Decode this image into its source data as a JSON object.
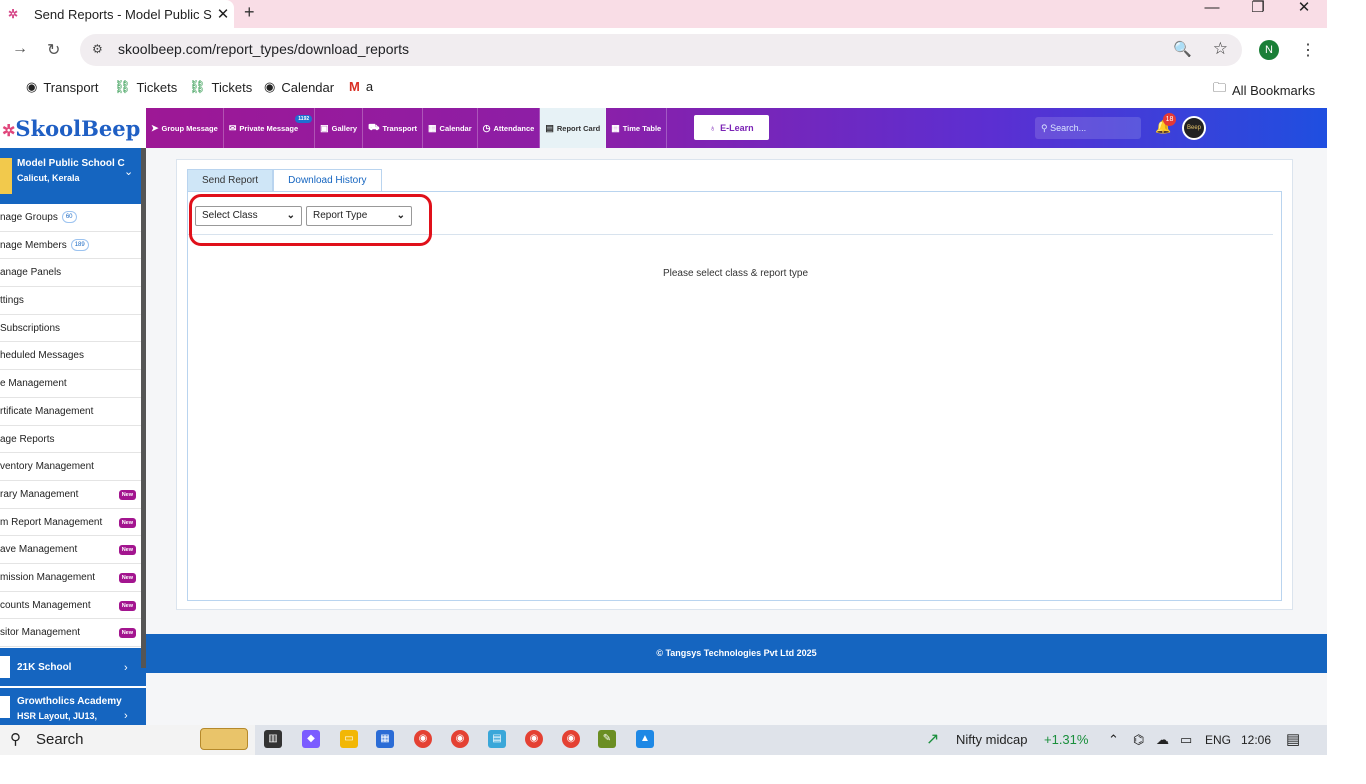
{
  "browser": {
    "tab_title": "Send Reports - Model Public Sc",
    "url": "skoolbeep.com/report_types/download_reports",
    "profile_initial": "N",
    "bookmarks": [
      "Transport",
      "Tickets",
      "Tickets",
      "Calendar",
      "a"
    ],
    "all_bookmarks": "All Bookmarks"
  },
  "app": {
    "logo": "SkoolBeep",
    "nav": [
      {
        "label": "Group Message"
      },
      {
        "label": "Private Message",
        "badge": "1192"
      },
      {
        "label": "Gallery"
      },
      {
        "label": "Transport"
      },
      {
        "label": "Calendar"
      },
      {
        "label": "Attendance"
      },
      {
        "label": "Report Card"
      },
      {
        "label": "Time Table"
      }
    ],
    "elearn": "E-Learn",
    "search_placeholder": "Search...",
    "notif_count": "18",
    "avatar_text": "Beep"
  },
  "sidebar": {
    "school_name": "Model Public School C",
    "school_location": "Calicut, Kerala",
    "items": [
      {
        "label": "nage Groups",
        "count": "60"
      },
      {
        "label": "nage Members",
        "count": "189"
      },
      {
        "label": "anage Panels"
      },
      {
        "label": "ttings"
      },
      {
        "label": " Subscriptions"
      },
      {
        "label": "heduled Messages"
      },
      {
        "label": "e Management"
      },
      {
        "label": "rtificate Management"
      },
      {
        "label": "age Reports"
      },
      {
        "label": "ventory Management"
      },
      {
        "label": "rary Management",
        "badge": "New"
      },
      {
        "label": "m Report Management",
        "badge": "New"
      },
      {
        "label": "ave Management",
        "badge": "New"
      },
      {
        "label": "mission Management",
        "badge": "New"
      },
      {
        "label": "counts Management",
        "badge": "New"
      },
      {
        "label": "sitor Management",
        "badge": "New"
      }
    ],
    "school2": "21K School",
    "school3_name": "Growtholics Academy",
    "school3_location": "HSR Layout, JU13,"
  },
  "main": {
    "tabs": [
      "Send Report",
      "Download History"
    ],
    "select_class": "Select Class",
    "report_type": "Report Type",
    "message": "Please select class & report type"
  },
  "footer": "© Tangsys Technologies Pvt Ltd 2025",
  "taskbar": {
    "search": "Search",
    "ticker_name": "Nifty midcap",
    "ticker_change": "+1.31%",
    "lang": "ENG",
    "time": "12:06"
  }
}
